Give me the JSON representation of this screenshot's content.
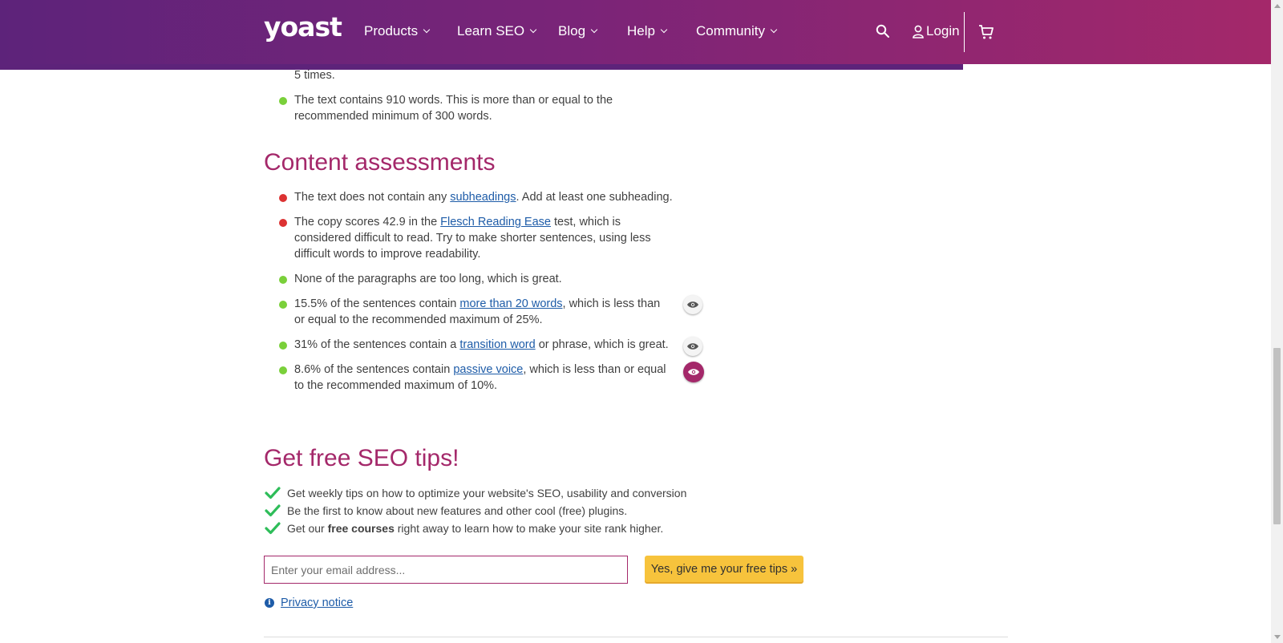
{
  "header": {
    "logo": "yoast",
    "nav": [
      {
        "label": "Products"
      },
      {
        "label": "Learn SEO"
      },
      {
        "label": "Blog"
      },
      {
        "label": "Help"
      },
      {
        "label": "Community"
      }
    ],
    "login_label": "Login"
  },
  "seo_list": {
    "items": [
      {
        "text": "5 times.",
        "status": "none"
      },
      {
        "text": "The text contains 910 words. This is more than or equal to the recommended minimum of 300 words.",
        "status": "green"
      }
    ]
  },
  "content_assessments": {
    "title": "Content assessments",
    "items": [
      {
        "pre": "The text does not contain any ",
        "link": "subheadings",
        "post": ". Add at least one subheading.",
        "status": "red"
      },
      {
        "pre": "The copy scores 42.9 in the ",
        "link": "Flesch Reading Ease",
        "post": " test, which is considered difficult to read. Try to make shorter sentences, using less difficult words to improve readability.",
        "status": "red"
      },
      {
        "pre": "None of the paragraphs are too long, which is great.",
        "link": "",
        "post": "",
        "status": "green"
      },
      {
        "pre": "15.5% of the sentences contain ",
        "link": "more than 20 words",
        "post": ", which is less than or equal to the recommended maximum of 25%.",
        "status": "green"
      },
      {
        "pre": "31% of the sentences contain a ",
        "link": "transition word",
        "post": " or phrase, which is great.",
        "status": "green"
      },
      {
        "pre": "8.6% of the sentences contain ",
        "link": "passive voice",
        "post": ", which is less than or equal to the recommended maximum of 10%.",
        "status": "green"
      }
    ]
  },
  "newsletter": {
    "title": "Get free SEO tips!",
    "tips": [
      {
        "pre": "Get weekly tips on how to optimize your website's SEO, usability and conversion",
        "bold": "",
        "post": ""
      },
      {
        "pre": "Be the first to know about new features and other cool (free) plugins.",
        "bold": "",
        "post": ""
      },
      {
        "pre": "Get our ",
        "bold": "free courses",
        "post": " right away to learn how to make your site rank higher."
      }
    ],
    "email_placeholder": "Enter your email address...",
    "cta_label": "Yes, give me your free tips »",
    "privacy_label": "Privacy notice"
  },
  "colors": {
    "brand": "#a4286a",
    "header_start": "#5d237a",
    "green": "#7ad03a",
    "red": "#dc3232",
    "link": "#1e5ca8",
    "cta": "#f7c33c"
  }
}
